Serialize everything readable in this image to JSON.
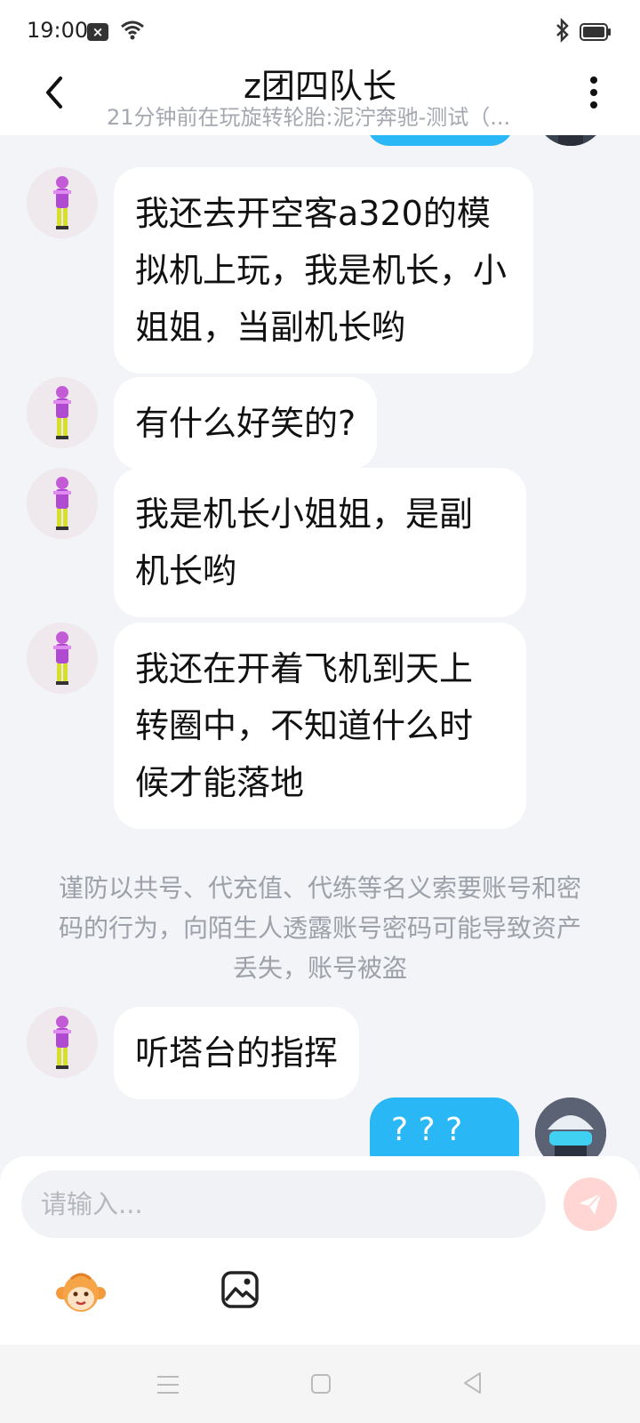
{
  "status_bar": {
    "time": "19:00",
    "notification_icon": "close-notification-icon",
    "icons": [
      "wifi-icon",
      "bluetooth-icon",
      "battery-icon"
    ]
  },
  "header": {
    "title": "z团四队长",
    "subtitle": "21分钟前在玩旋转轮胎:泥泞奔驰-测试（..."
  },
  "messages": [
    {
      "direction": "in",
      "text": "我还去开空客a320的模拟机上玩，我是机长，小姐姐，当副机长哟"
    },
    {
      "direction": "in",
      "text": "有什么好笑的?"
    },
    {
      "direction": "in",
      "text": "我是机长小姐姐，是副机长哟"
    },
    {
      "direction": "in",
      "text": "我还在开着飞机到天上转圈中，不知道什么时候才能落地"
    },
    {
      "direction": "in",
      "text": "听塔台的指挥"
    },
    {
      "direction": "out",
      "text": "? ? ?"
    }
  ],
  "system_note": "谨防以共号、代充值、代练等名义索要账号和密码的行为，向陌生人透露账号密码可能导致资产丢失，账号被盗",
  "input": {
    "placeholder": "请输入...",
    "value": ""
  },
  "toolbar": {
    "icons": [
      "monkey-emoji-icon",
      "image-icon"
    ]
  },
  "colors": {
    "background": "#f2f4f8",
    "outgoing_bubble": "#2ab7f6",
    "incoming_bubble": "#ffffff",
    "send_button": "#ffd6d3",
    "note_text": "#9da1a9"
  }
}
